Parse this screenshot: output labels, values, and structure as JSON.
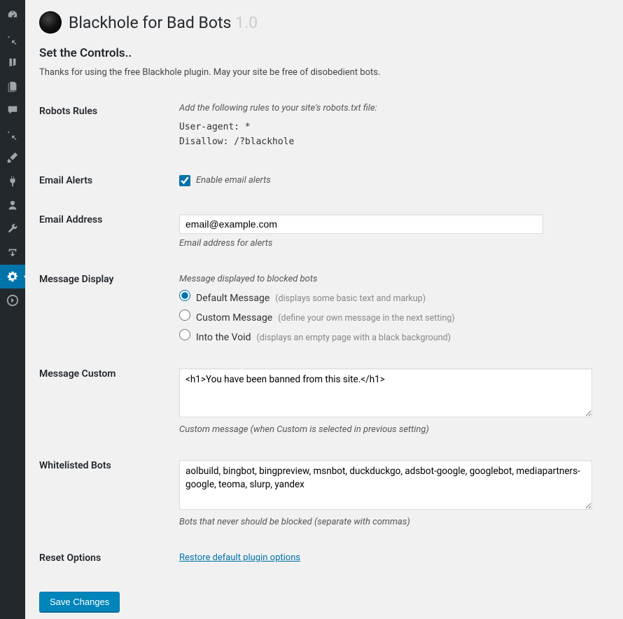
{
  "header": {
    "title": "Blackhole for Bad Bots",
    "version": "1.0"
  },
  "section": {
    "heading": "Set the Controls..",
    "intro": "Thanks for using the free Blackhole plugin. May your site be free of disobedient bots."
  },
  "robots_rules": {
    "label": "Robots Rules",
    "desc": "Add the following rules to your site's robots.txt file:",
    "code": "User-agent: *\nDisallow: /?blackhole"
  },
  "email_alerts": {
    "label": "Email Alerts",
    "checkbox_label": "Enable email alerts",
    "checked": true
  },
  "email_address": {
    "label": "Email Address",
    "value": "email@example.com",
    "note": "Email address for alerts"
  },
  "message_display": {
    "label": "Message Display",
    "desc": "Message displayed to blocked bots",
    "options": [
      {
        "title": "Default Message",
        "hint": "(displays some basic text and markup)"
      },
      {
        "title": "Custom Message",
        "hint": "(define your own message in the next setting)"
      },
      {
        "title": "Into the Void",
        "hint": "(displays an empty page with a black background)"
      }
    ],
    "selected": 0
  },
  "message_custom": {
    "label": "Message Custom",
    "value": "<h1>You have been banned from this site.</h1>",
    "note": "Custom message (when Custom is selected in previous setting)"
  },
  "whitelisted_bots": {
    "label": "Whitelisted Bots",
    "value": "aolbuild, bingbot, bingpreview, msnbot, duckduckgo, adsbot-google, googlebot, mediapartners-google, teoma, slurp, yandex",
    "note": "Bots that never should be blocked (separate with commas)"
  },
  "reset": {
    "label": "Reset Options",
    "link": "Restore default plugin options"
  },
  "save_button": "Save Changes"
}
